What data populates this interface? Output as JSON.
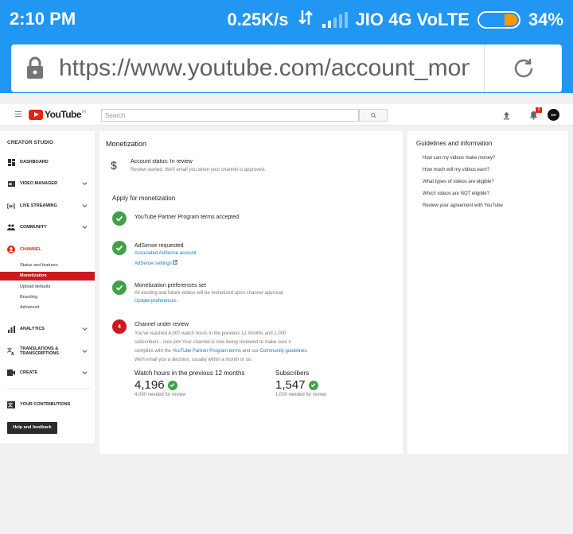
{
  "status_bar": {
    "time": "2:10 PM",
    "speed": "0.25K/s",
    "carrier": "JIO 4G VoLTE",
    "battery": "34%",
    "battery_level": 0.34,
    "color": "#2196f3"
  },
  "browser": {
    "url": "https://www.youtube.com/account_monet"
  },
  "header": {
    "logo_text": "YouTube",
    "logo_tm": "IN",
    "search_placeholder": "Search",
    "notification_count": "3",
    "avatar_text": "MH"
  },
  "sidebar": {
    "title": "CREATOR STUDIO",
    "items": [
      {
        "label": "DASHBOARD",
        "icon": "dashboard-icon"
      },
      {
        "label": "VIDEO MANAGER",
        "icon": "video-manager-icon"
      },
      {
        "label": "LIVE STREAMING",
        "icon": "live-icon"
      },
      {
        "label": "COMMUNITY",
        "icon": "community-icon"
      },
      {
        "label": "CHANNEL",
        "icon": "channel-icon"
      },
      {
        "label": "ANALYTICS",
        "icon": "analytics-icon"
      },
      {
        "label": "TRANSLATIONS &",
        "label2": "TRANSCRIPTIONS",
        "icon": "translate-icon"
      },
      {
        "label": "CREATE",
        "icon": "create-icon"
      },
      {
        "label": "YOUR CONTRIBUTIONS",
        "icon": "contributions-icon"
      }
    ],
    "channel_sub": [
      "Status and features",
      "Monetization",
      "Upload defaults",
      "Branding",
      "Advanced"
    ],
    "help_button": "Help and feedback"
  },
  "main": {
    "heading": "Monetization",
    "account_status": "Account status: In review",
    "account_status_note": "Review started. We'll email you when your channel is approved.",
    "apply_heading": "Apply for monetization",
    "steps": {
      "s1_title": "YouTube Partner Program terms accepted",
      "s2_title": "AdSense requested",
      "s2_link1": "Associated AdSense account",
      "s2_link2": "AdSense settings",
      "s3_title": "Monetization preferences set",
      "s3_note": "All existing and future videos will be monetized upon channel approval.",
      "s3_link": "Update preferences",
      "s4_number": "4",
      "s4_title": "Channel under review",
      "s4_line1": "You've reached 4,000 watch hours in the previous 12 months and 1,000",
      "s4_line2": "subscribers - nice job! Your channel is now being reviewed to make sure it",
      "s4_line3a": "complies with the ",
      "s4_line3_link1": "YouTube Partner Program terms",
      "s4_line3b": " and our ",
      "s4_line3_link2": "Community guidelines",
      "s4_line3c": ".",
      "s4_line4": "We'll email you a decision, usually within a month or so."
    },
    "stats": {
      "watch_label": "Watch hours in the previous 12 months",
      "watch_value": "4,196",
      "watch_need": "4,000 needed for review",
      "subs_label": "Subscribers",
      "subs_value": "1,547",
      "subs_need": "1,000 needed for review"
    }
  },
  "guidelines": {
    "heading": "Guidelines and information",
    "links": [
      "How can my videos make money?",
      "How much will my videos earn?",
      "What types of videos are eligible?",
      "Which videos are NOT eligible?",
      "Review your agreement with YouTube"
    ]
  }
}
